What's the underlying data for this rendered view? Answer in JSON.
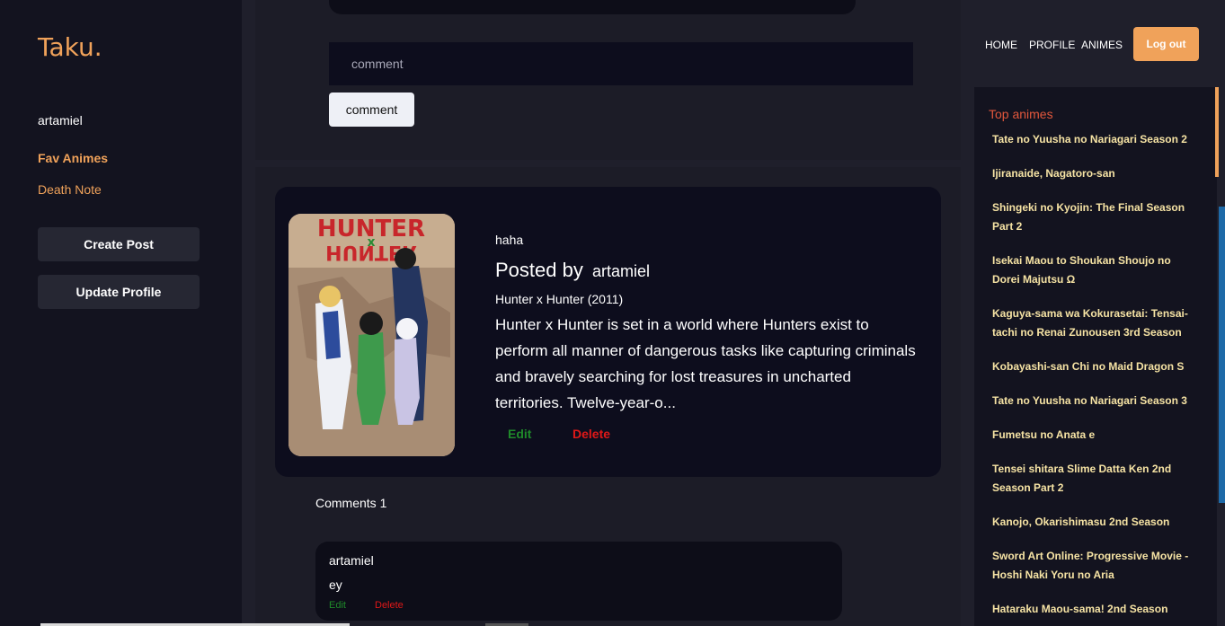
{
  "sidebar": {
    "logo": "Taku.",
    "username": "artamiel",
    "fav_heading": "Fav Animes",
    "fav_items": [
      "Death Note"
    ],
    "create_post": "Create Post",
    "update_profile": "Update Profile"
  },
  "comment_form": {
    "placeholder": "comment",
    "button": "comment"
  },
  "post": {
    "caption": "haha",
    "posted_by_label": "Posted by",
    "author": "artamiel",
    "anime_title": "Hunter x Hunter (2011)",
    "description": "Hunter x Hunter is set in a world where Hunters exist to perform all manner of dangerous tasks like capturing criminals and bravely searching for lost treasures in uncharted territories. Twelve-year-o...",
    "edit": "Edit",
    "delete": "Delete",
    "poster_alt": "HUNTER x HUNTER"
  },
  "comments": {
    "count_label": "Comments 1",
    "items": [
      {
        "user": "artamiel",
        "text": "ey",
        "edit": "Edit",
        "delete": "Delete"
      }
    ]
  },
  "nav": {
    "home": "HOME",
    "profile": "PROFILE",
    "animes": "ANIMES",
    "logout": "Log out"
  },
  "top_animes": {
    "title": "Top animes",
    "items": [
      "Tate no Yuusha no Nariagari Season 2",
      "Ijiranaide, Nagatoro-san",
      "Shingeki no Kyojin: The Final Season Part 2",
      "Isekai Maou to Shoukan Shoujo no Dorei Majutsu Ω",
      "Kaguya-sama wa Kokurasetai: Tensai-tachi no Renai Zunousen 3rd Season",
      "Kobayashi-san Chi no Maid Dragon S",
      "Tate no Yuusha no Nariagari Season 3",
      "Fumetsu no Anata e",
      "Tensei shitara Slime Datta Ken 2nd Season Part 2",
      "Kanojo, Okarishimasu 2nd Season",
      "Sword Art Online: Progressive Movie - Hoshi Naki Yoru no Aria",
      "Hataraku Maou-sama! 2nd Season"
    ]
  },
  "colors": {
    "accent": "#f0a25a",
    "background": "#1f1f2b",
    "card": "#0d0d1d",
    "top_title": "#e2573c",
    "top_item": "#f6e3a4",
    "edit": "#1f8a2a",
    "delete": "#e01818"
  }
}
